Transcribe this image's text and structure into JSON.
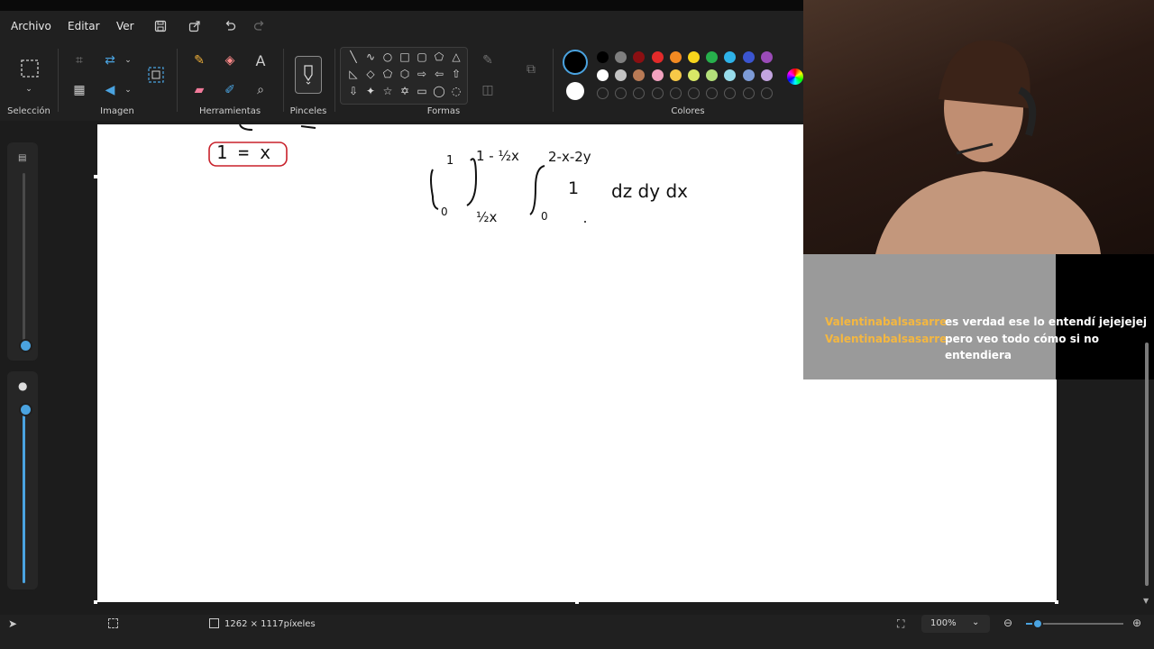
{
  "menu": {
    "archivo": "Archivo",
    "editar": "Editar",
    "ver": "Ver"
  },
  "ribbon": {
    "groups": {
      "seleccion": "Selección",
      "imagen": "Imagen",
      "herramientas": "Herramientas",
      "pinceles": "Pinceles",
      "formas": "Formas",
      "colores": "Colores"
    },
    "palette_top": [
      "#000000",
      "#7f7f7f",
      "#8b0f12",
      "#e22a2a",
      "#f28a22",
      "#f7d51c",
      "#27b04c",
      "#2eb2e8",
      "#3b55d0",
      "#9b4bb8"
    ],
    "palette_bottom": [
      "#ffffff",
      "#c3c3c3",
      "#b87a55",
      "#f2a2c0",
      "#f7c948",
      "#d8e867",
      "#b4e07a",
      "#98dcea",
      "#7d9bd6",
      "#c3a4e0"
    ],
    "primary_color": "#000000",
    "secondary_color": "#ffffff"
  },
  "canvas": {
    "boxed_answer": "1 = x",
    "integral": {
      "outer_upper": "1",
      "outer_lower": "0",
      "middle_upper": "1 - ½x",
      "middle_lower": "½x",
      "inner_upper": "2-x-2y",
      "inner_lower": "0",
      "integrand": "1",
      "differentials": "dz dy dx"
    }
  },
  "chat": [
    {
      "user": "Valentinabalsasarre",
      "message": "es verdad ese lo entendí jejejejej"
    },
    {
      "user": "Valentinabalsasarre",
      "message_line1": "pero veo todo cómo si no",
      "message_line2": "entendiera"
    }
  ],
  "status": {
    "dimensions": "1262 × 1117píxeles",
    "zoom": "100%",
    "zoom_fraction": 0.12
  },
  "colors": {
    "accent": "#4aa3e0",
    "chat_user": "#f4b740",
    "boxed_answer_outline": "#c8202a"
  }
}
